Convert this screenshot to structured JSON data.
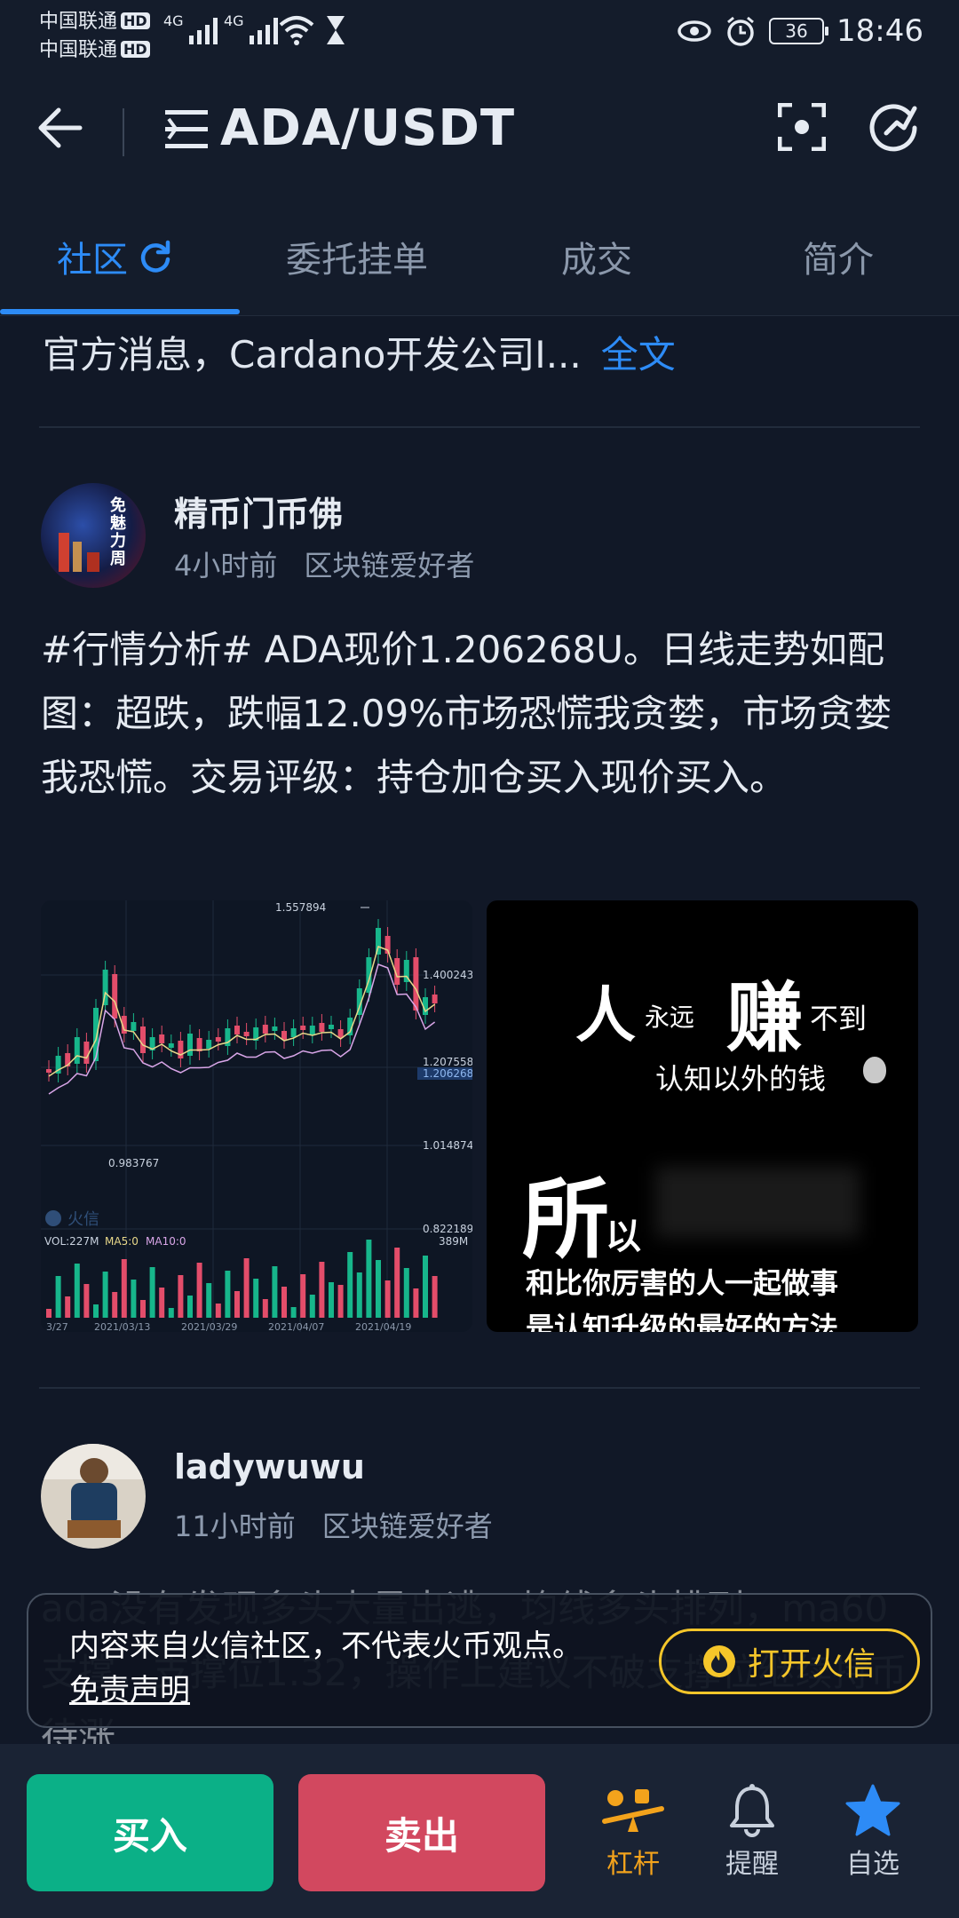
{
  "status_bar": {
    "carrier1": "中国联通",
    "carrier2": "中国联通",
    "hd_badge": "HD",
    "network1": "4G",
    "network2": "4G",
    "battery": "36",
    "time": "18:46"
  },
  "header": {
    "title": "ADA/USDT"
  },
  "tabs": [
    {
      "label": "社区"
    },
    {
      "label": "委托挂单"
    },
    {
      "label": "成交"
    },
    {
      "label": "简介"
    }
  ],
  "news": {
    "text": "官方消息，Cardano开发公司I...",
    "full_link": "全文"
  },
  "posts": [
    {
      "author": "精币门币佛",
      "time": "4小时前",
      "tag": "区块链爱好者",
      "body": "#行情分析# ADA现价1.206268U。日线走势如配图：超跌，跌幅12.09%市场恐慌我贪婪，市场贪婪我恐慌。交易评级：持仓加仓买入现价买入。",
      "avatar_text": "免魅力周"
    },
    {
      "author": "ladywuwu",
      "time": "11小时前",
      "tag": "区块链爱好者",
      "body": "ada没有发现多头大量出逃，均线多头排列，ma60支撑，支撑位1.32，操作上建议不破支撑位继续持币待涨"
    }
  ],
  "chart_image": {
    "high_label": "1.557894",
    "low_label": "0.983767",
    "y_ticks": [
      "1.400243",
      "1.207558",
      "1.206268",
      "1.014874",
      "0.822189"
    ],
    "vol_max": "389M",
    "watermark": "火信",
    "vol_label": "VOL:227M",
    "ma5_label": "MA5:0",
    "ma10_label": "MA10:0",
    "x_ticks": [
      "3/27",
      "2021/03/13",
      "2021/03/29",
      "2021/04/07",
      "2021/04/19"
    ],
    "colors": {
      "up": "#17b68b",
      "down": "#e34d6a"
    }
  },
  "quote_image": {
    "line1_a": "人",
    "line1_b": "永远",
    "line1_c": "赚",
    "line1_d": "不到",
    "line2": "认知以外的钱",
    "line3_a": "所",
    "line3_b": "以",
    "line4": "和比你厉害的人一起做事",
    "line5": "是认知升级的最好的方法"
  },
  "banner": {
    "text": "内容来自火信社区，不代表火币观点。",
    "link": "免责声明",
    "open_button": "打开火信"
  },
  "bottom_bar": {
    "buy": "买入",
    "sell": "卖出",
    "nav": [
      {
        "label": "杠杆",
        "icon": "leverage-icon"
      },
      {
        "label": "提醒",
        "icon": "bell-icon"
      },
      {
        "label": "自选",
        "icon": "star-icon"
      }
    ]
  },
  "colors": {
    "accent": "#2d8bf6",
    "buy": "#0bb087",
    "sell": "#d2485f",
    "leverage": "#f3a31c",
    "banner_button": "#f5c62a"
  }
}
